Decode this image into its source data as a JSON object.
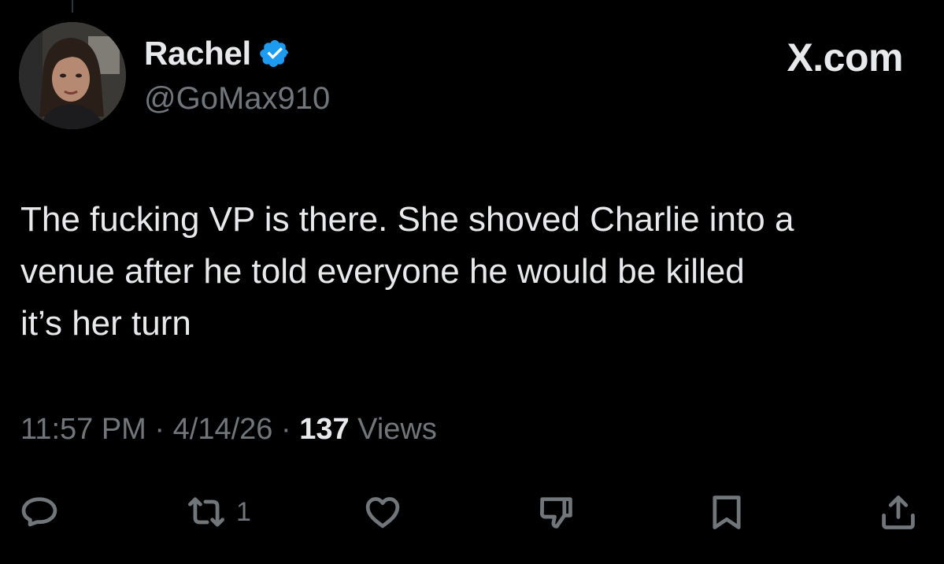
{
  "author": {
    "display_name": "Rachel",
    "handle": "@GoMax910",
    "verified": true
  },
  "brand": "X.com",
  "tweet": {
    "text": "The fucking VP is there. She shoved Charlie into a\nvenue after he told everyone he would be killed\nit’s her turn"
  },
  "meta": {
    "time": "11:57 PM",
    "date": "4/14/26",
    "views_count": "137",
    "views_label": "Views",
    "separator": "·"
  },
  "actions": {
    "reposts_count": "1"
  },
  "icons": {
    "reply": "reply-icon",
    "repost": "repost-icon",
    "like": "heart-icon",
    "dislike": "thumbs-down-icon",
    "bookmark": "bookmark-icon",
    "share": "share-icon",
    "verified": "verified-badge-icon"
  },
  "colors": {
    "background": "#000000",
    "primary_text": "#e7e9ea",
    "secondary_text": "#71767b",
    "verified_blue": "#1d9bf0"
  }
}
